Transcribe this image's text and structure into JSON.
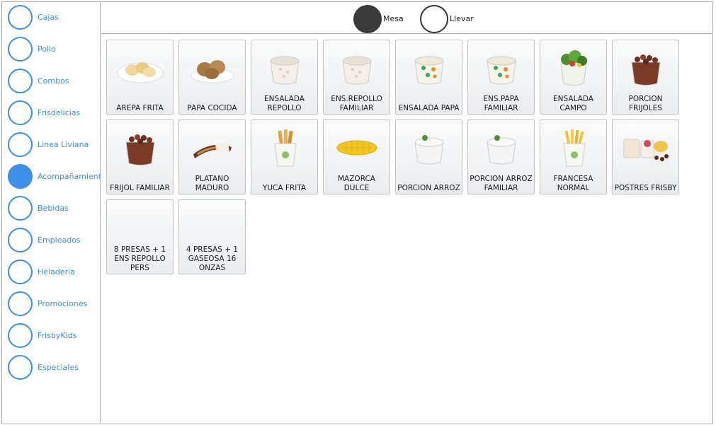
{
  "sidebar": {
    "items": [
      {
        "label": "Cajas",
        "active": false
      },
      {
        "label": "Pollo",
        "active": false
      },
      {
        "label": "Combos",
        "active": false
      },
      {
        "label": "Frisdelicias",
        "active": false
      },
      {
        "label": "Linea Liviana",
        "active": false
      },
      {
        "label": "Acompañamientos",
        "active": true
      },
      {
        "label": "Bebidas",
        "active": false
      },
      {
        "label": "Empleados",
        "active": false
      },
      {
        "label": "Heladeria",
        "active": false
      },
      {
        "label": "Promociones",
        "active": false
      },
      {
        "label": "FrisbyKids",
        "active": false
      },
      {
        "label": "Especiales",
        "active": false
      }
    ]
  },
  "order_type": {
    "options": [
      {
        "label": "Mesa",
        "selected": true
      },
      {
        "label": "Llevar",
        "selected": false
      }
    ]
  },
  "products": [
    {
      "name": "AREPA FRITA",
      "icon": "arepa-plate-icon"
    },
    {
      "name": "PAPA COCIDA",
      "icon": "potatoes-plate-icon"
    },
    {
      "name": "ENSALADA REPOLLO",
      "icon": "coleslaw-cup-icon"
    },
    {
      "name": "ENS.REPOLLO FAMILIAR",
      "icon": "coleslaw-cup-icon"
    },
    {
      "name": "ENSALADA PAPA",
      "icon": "potato-salad-cup-icon"
    },
    {
      "name": "ENS.PAPA FAMILIAR",
      "icon": "potato-salad-cup-icon"
    },
    {
      "name": "ENSALADA CAMPO",
      "icon": "green-salad-cup-icon"
    },
    {
      "name": "PORCION FRIJOLES",
      "icon": "beans-cup-icon"
    },
    {
      "name": "FRIJOL FAMILIAR",
      "icon": "beans-cup-icon"
    },
    {
      "name": "PLATANO MADURO",
      "icon": "plantain-icon"
    },
    {
      "name": "YUCA FRITA",
      "icon": "yuca-fries-bag-icon"
    },
    {
      "name": "MAZORCA DULCE",
      "icon": "corn-cob-icon"
    },
    {
      "name": "PORCION ARROZ",
      "icon": "rice-cup-icon"
    },
    {
      "name": "PORCION ARROZ FAMILIAR",
      "icon": "rice-cup-icon"
    },
    {
      "name": "FRANCESA NORMAL",
      "icon": "french-fries-icon"
    },
    {
      "name": "POSTRES FRISBY",
      "icon": "desserts-icon"
    },
    {
      "name": "8 PRESAS + 1 ENS REPOLLO PERS",
      "icon": ""
    },
    {
      "name": "4 PRESAS + 1 GASEOSA 16 ONZAS",
      "icon": ""
    }
  ],
  "colors": {
    "accent": "#3a8ee6",
    "radio_selected": "#3a3a3a"
  }
}
